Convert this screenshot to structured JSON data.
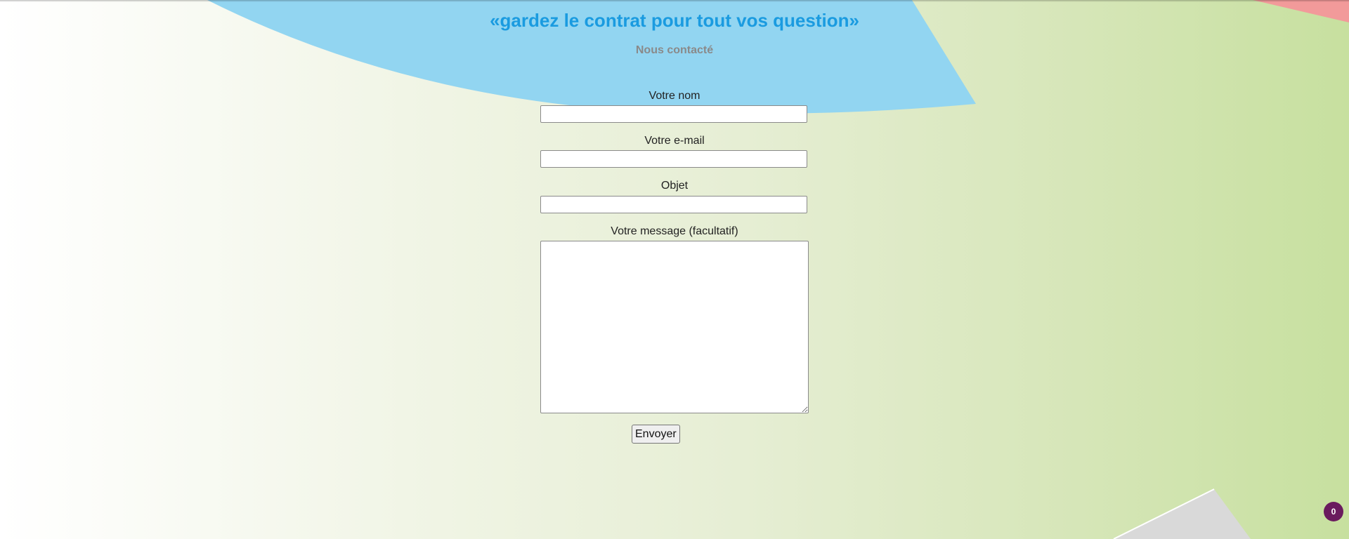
{
  "header": {
    "title": "«gardez le contrat pour tout vos question»",
    "subtitle": "Nous contacté"
  },
  "form": {
    "name_label": "Votre nom",
    "name_value": "",
    "email_label": "Votre e-mail",
    "email_value": "",
    "subject_label": "Objet",
    "subject_value": "",
    "message_label": "Votre message (facultatif)",
    "message_value": "",
    "submit_label": "Envoyer"
  },
  "badge": {
    "count": "0"
  },
  "colors": {
    "title": "#1a9be0",
    "subtitle": "#8a8a8a",
    "blue_shape": "#8fd3f0",
    "red_shape": "#f29c9c",
    "gray_shape": "#d6d6d6",
    "badge": "#6a1b5e"
  }
}
